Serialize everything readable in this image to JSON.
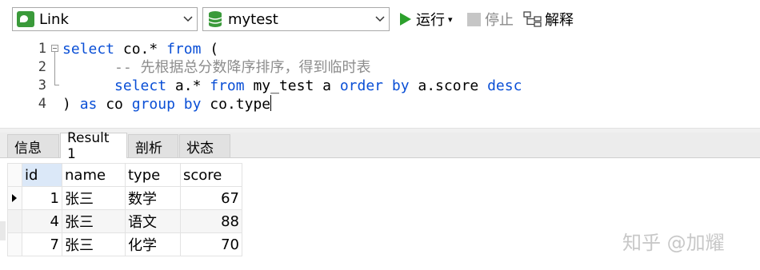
{
  "toolbar": {
    "connection": "Link",
    "database": "mytest",
    "run_label": "运行",
    "run_dropdown": "▾",
    "stop_label": "停止",
    "explain_label": "解释",
    "colors": {
      "run_green": "#2ca02c",
      "connection_green": "#3a9a3a"
    }
  },
  "editor": {
    "line_numbers": [
      "1",
      "2",
      "3",
      "4"
    ],
    "lines": [
      [
        "select",
        " co.* ",
        "from",
        " ("
      ],
      [
        "      -- 先根据总分数降序排序，得到临时表"
      ],
      [
        "      ",
        "select",
        " a.* ",
        "from",
        " my_test a ",
        "order",
        " ",
        "by",
        " a.score ",
        "desc"
      ],
      [
        ") ",
        "as",
        " co ",
        "group",
        " ",
        "by",
        " co.type"
      ]
    ]
  },
  "results": {
    "tabs": [
      "信息",
      "Result 1",
      "剖析",
      "状态"
    ],
    "active_tab": "Result 1",
    "columns": [
      "id",
      "name",
      "type",
      "score"
    ],
    "rows": [
      [
        "1",
        "张三",
        "数学",
        "67"
      ],
      [
        "4",
        "张三",
        "语文",
        "88"
      ],
      [
        "7",
        "张三",
        "化学",
        "70"
      ]
    ]
  },
  "watermark": "知乎 @加耀"
}
